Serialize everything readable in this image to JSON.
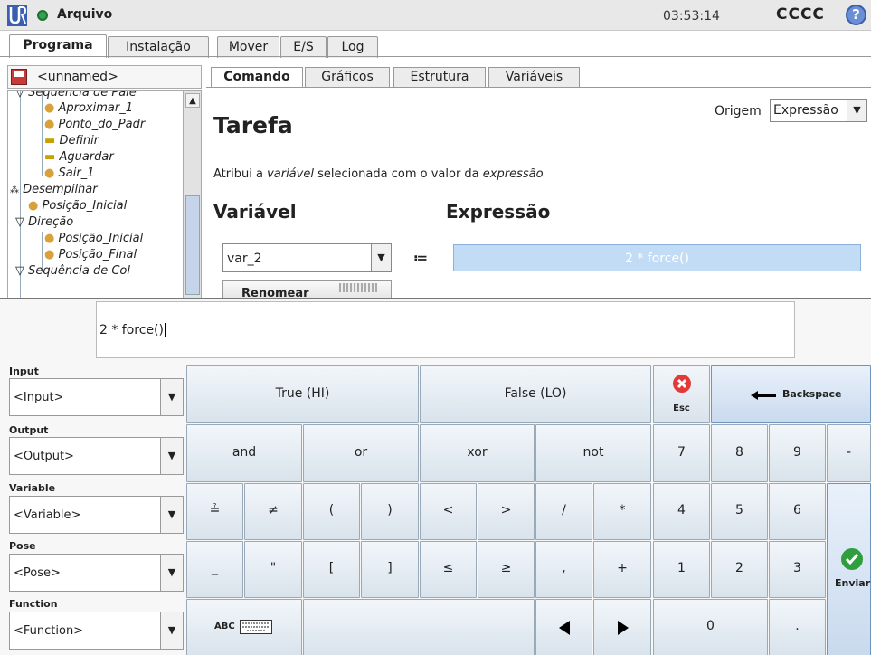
{
  "topbar": {
    "file_menu": "Arquivo",
    "clock": "03:53:14",
    "robot_name": "CCCC",
    "help": "?"
  },
  "main_tabs": [
    "Programa",
    "Instalação",
    "Mover",
    "E/S",
    "Log"
  ],
  "left": {
    "program_name": "<unnamed>",
    "tree": [
      "Sequência de Palé",
      "Aproximar_1",
      "Ponto_do_Padr",
      "Definir",
      "Aguardar",
      "Sair_1",
      "Desempilhar",
      "Posição_Inicial",
      "Direção",
      "Posição_Inicial",
      "Posição_Final",
      "Sequência de Col"
    ]
  },
  "sub_tabs": [
    "Comando",
    "Gráficos",
    "Estrutura",
    "Variáveis"
  ],
  "command": {
    "origin_label": "Origem",
    "origin_value": "Expressão",
    "title": "Tarefa",
    "desc_pre": "Atribui a ",
    "desc_var": "variável",
    "desc_mid": " selecionada com o valor da ",
    "desc_expr": "expressão",
    "variable_label": "Variável",
    "expression_label": "Expressão",
    "variable_value": "var_2",
    "assign_symbol": "≔",
    "expression_value": "2 * force()",
    "rename_label": "Renomear"
  },
  "keyboard": {
    "input_value": "2 * force()",
    "selectors": [
      {
        "label": "Input",
        "value": "<Input>"
      },
      {
        "label": "Output",
        "value": "<Output>"
      },
      {
        "label": "Variable",
        "value": "<Variable>"
      },
      {
        "label": "Pose",
        "value": "<Pose>"
      },
      {
        "label": "Function",
        "value": "<Function>"
      }
    ],
    "keys": {
      "true": "True (HI)",
      "false": "False (LO)",
      "esc": "Esc",
      "backspace": "Backspace",
      "and": "and",
      "or": "or",
      "xor": "xor",
      "not": "not",
      "eq": "≟",
      "neq": "≠",
      "lparen": "(",
      "rparen": ")",
      "lt": "<",
      "gt": ">",
      "div": "/",
      "mul": "*",
      "underscore": "_",
      "quote": "\"",
      "lbracket": "[",
      "rbracket": "]",
      "le": "≤",
      "ge": "≥",
      "comma": ",",
      "plus": "+",
      "abc": "ABC",
      "n7": "7",
      "n8": "8",
      "n9": "9",
      "minus": "-",
      "n4": "4",
      "n5": "5",
      "n6": "6",
      "n1": "1",
      "n2": "2",
      "n3": "3",
      "n0": "0",
      "dot": ".",
      "submit": "Enviar"
    }
  }
}
